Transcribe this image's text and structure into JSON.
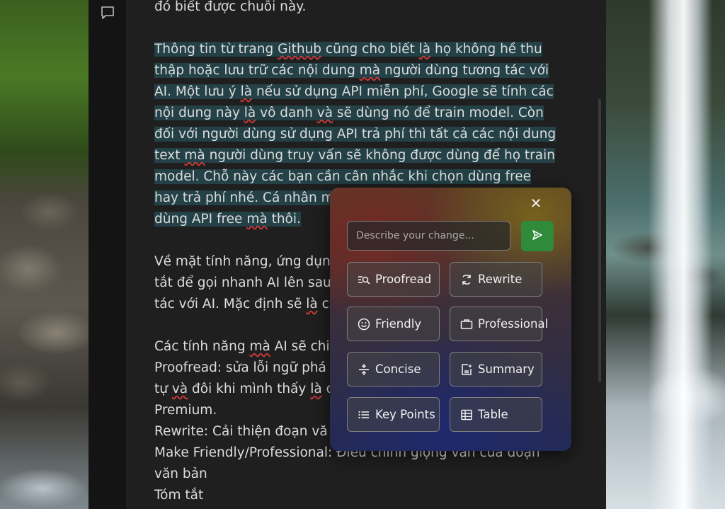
{
  "document": {
    "line_top": "đó biết được chuỗi này.",
    "para_selected": [
      "Thông tin từ trang ",
      "Github",
      " cũng cho biết ",
      "là",
      " họ không hề thu",
      "thập hoặc lưu trữ các nội dung ",
      "mà",
      " người dùng tương tác với",
      "AI. Một lưu ý ",
      "là",
      " nếu sử dụng API miễn phí, Google sẽ tính các",
      "nội dung này ",
      "là",
      " vô danh ",
      "và",
      " sẽ dùng nó để train model. Còn",
      "đối với người dùng sử dụng API trả phí thì tất cả các nội dung",
      "text ",
      "mà",
      " người dùng truy vấn sẽ không được dùng để họ train",
      "model. Chỗ này các bạn cần cân nhắc khi chọn dùng free",
      "hay trả phí nhé. Cá nhân m",
      "dùng API free ",
      "mà",
      " thôi."
    ],
    "para2_lines": [
      "Về mặt tính năng, ứng dụn",
      "tắt để gọi nhanh AI lên sau",
      "tác với AI. Mặc định sẽ ",
      "là",
      " c"
    ],
    "para3_lines": [
      "Các tính năng ",
      "mà",
      " AI sẽ chi",
      "Proofread: sửa lỗi ngữ phá",
      "tự ",
      "và",
      " đôi khi mình thấy ",
      "là",
      " c",
      "Premium.",
      "Rewrite: Cải thiện đoạn vă",
      "Make Friendly/Professional: Điều chỉnh giọng văn của đoạn",
      "văn bản",
      "Tóm tắt"
    ]
  },
  "popup": {
    "close_symbol": "✕",
    "input_placeholder": "Describe your change...",
    "input_value": "",
    "send_icon": "send-icon",
    "send_color": "#2f8a3a",
    "actions": [
      {
        "label": "Proofread",
        "icon": "proofread-icon"
      },
      {
        "label": "Rewrite",
        "icon": "rewrite-icon"
      },
      {
        "label": "Friendly",
        "icon": "smiley-icon"
      },
      {
        "label": "Professional",
        "icon": "briefcase-icon"
      },
      {
        "label": "Concise",
        "icon": "compress-icon"
      },
      {
        "label": "Summary",
        "icon": "summary-icon"
      },
      {
        "label": "Key Points",
        "icon": "list-icon"
      },
      {
        "label": "Table",
        "icon": "table-icon"
      }
    ]
  },
  "colors": {
    "selection": "#234146",
    "text": "#dcdcdc",
    "spellcheck": "#d23c3c"
  }
}
